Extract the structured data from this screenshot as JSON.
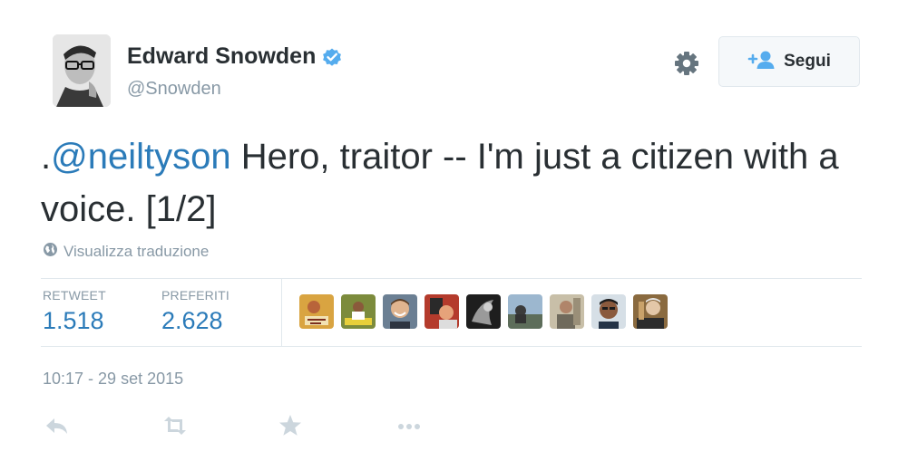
{
  "user": {
    "name": "Edward Snowden",
    "handle": "@Snowden",
    "verified": true
  },
  "follow_button": {
    "label": "Segui",
    "icon": "add-user-icon"
  },
  "settings_icon": "gear-icon",
  "tweet": {
    "prefix": ".",
    "mention": "@neiltyson",
    "text": " Hero, traitor -- I'm just a citizen with a voice. [1/2]"
  },
  "translate": {
    "label": "Visualizza traduzione",
    "icon": "globe-icon"
  },
  "stats": {
    "retweets_label": "RETWEET",
    "retweets_value": "1.518",
    "favorites_label": "PREFERITI",
    "favorites_value": "2.628"
  },
  "favoriters_count_shown": 9,
  "timestamp": "10:17 - 29 set 2015",
  "actions": [
    "reply-icon",
    "retweet-icon",
    "favorite-star-icon",
    "more-dots-icon"
  ],
  "colors": {
    "link": "#2b7bb9",
    "text": "#292f33",
    "muted": "#8899a6",
    "verified": "#55acee",
    "border": "#e1e8ed",
    "action_icons": "#ccd6dd"
  }
}
